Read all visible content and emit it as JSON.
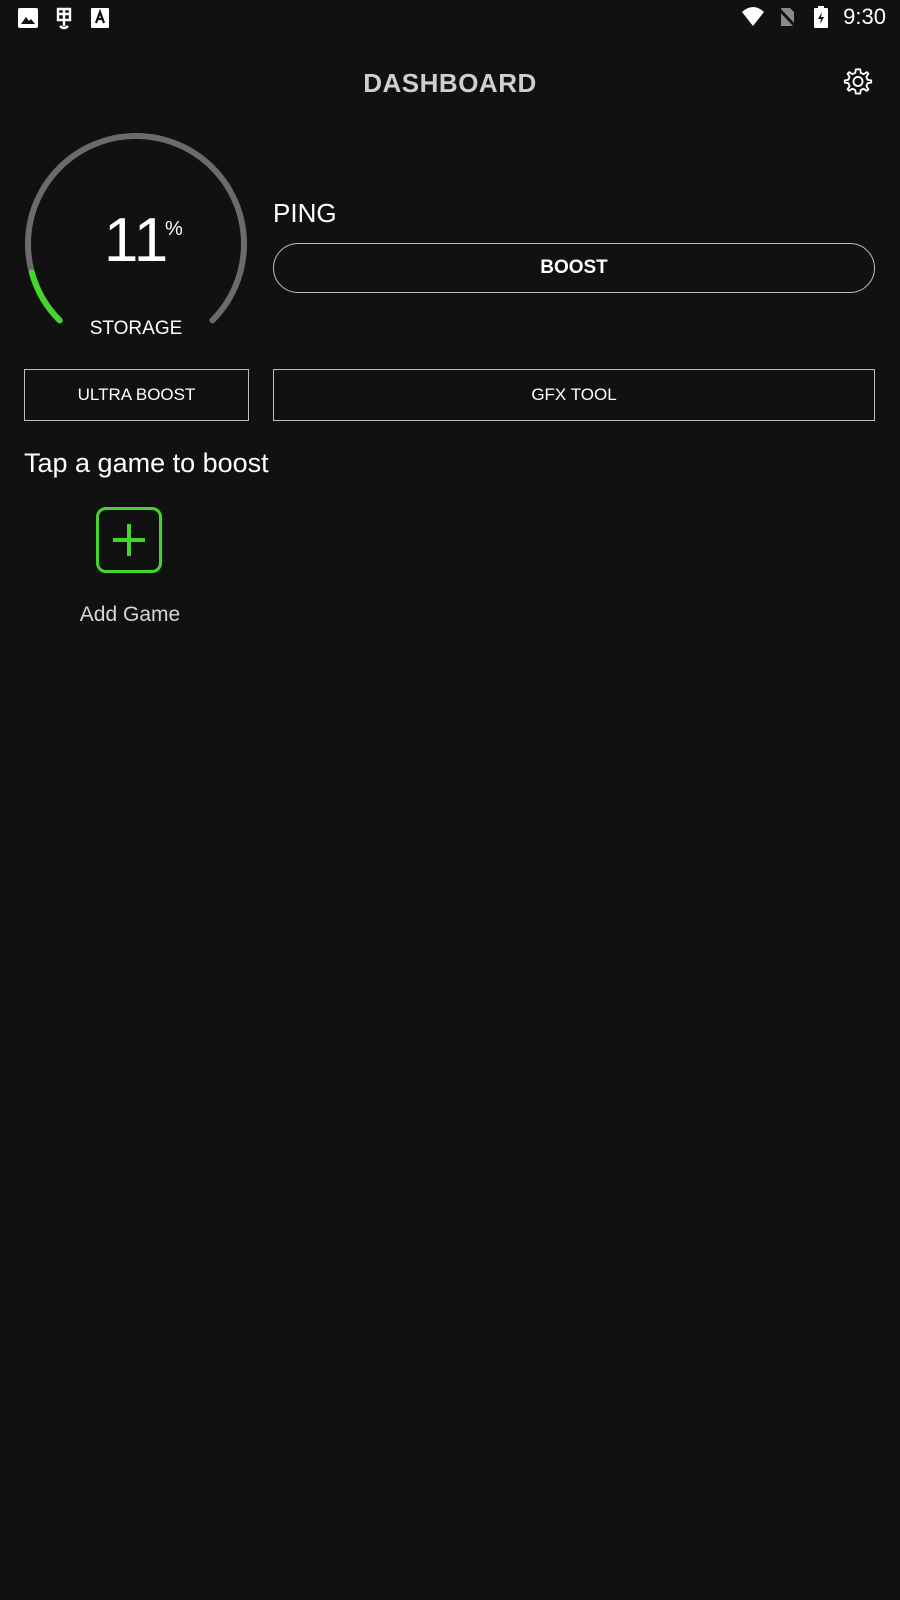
{
  "status_bar": {
    "time": "9:30",
    "left_icons": [
      "image-icon",
      "bug-icon",
      "font-icon"
    ],
    "right_icons": [
      "wifi-icon",
      "no-sim-icon",
      "battery-charging-icon"
    ]
  },
  "toolbar": {
    "title": "DASHBOARD",
    "settings_icon": "gear-icon"
  },
  "gauge": {
    "value": "11",
    "unit": "%",
    "label": "STORAGE",
    "fill_percent": 11,
    "track_color": "#6b6b6b",
    "fill_color": "#44d62c"
  },
  "ping": {
    "label": "PING",
    "boost_label": "BOOST"
  },
  "actions": {
    "ultra_boost_label": "ULTRA BOOST",
    "gfx_tool_label": "GFX TOOL"
  },
  "games": {
    "section_title": "Tap a game to boost",
    "add_game_label": "Add Game",
    "accent_color": "#44d62c"
  }
}
